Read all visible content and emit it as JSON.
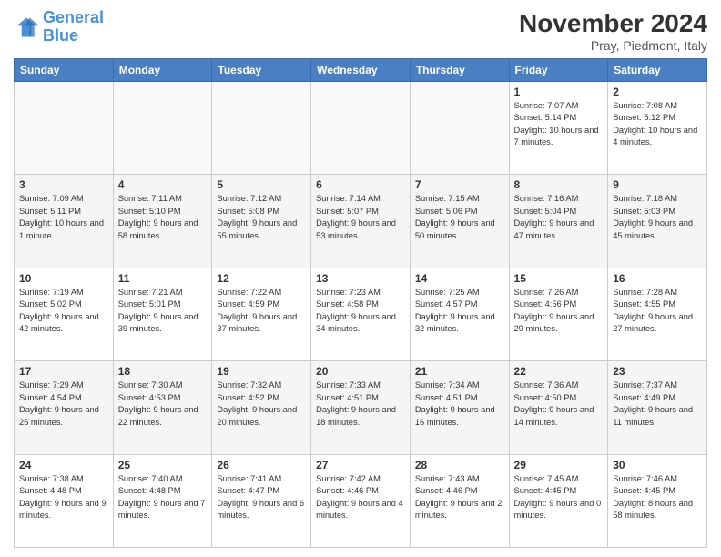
{
  "header": {
    "logo_line1": "General",
    "logo_line2": "Blue",
    "month_title": "November 2024",
    "location": "Pray, Piedmont, Italy"
  },
  "weekdays": [
    "Sunday",
    "Monday",
    "Tuesday",
    "Wednesday",
    "Thursday",
    "Friday",
    "Saturday"
  ],
  "rows": [
    [
      {
        "day": "",
        "info": ""
      },
      {
        "day": "",
        "info": ""
      },
      {
        "day": "",
        "info": ""
      },
      {
        "day": "",
        "info": ""
      },
      {
        "day": "",
        "info": ""
      },
      {
        "day": "1",
        "info": "Sunrise: 7:07 AM\nSunset: 5:14 PM\nDaylight: 10 hours and 7 minutes."
      },
      {
        "day": "2",
        "info": "Sunrise: 7:08 AM\nSunset: 5:12 PM\nDaylight: 10 hours and 4 minutes."
      }
    ],
    [
      {
        "day": "3",
        "info": "Sunrise: 7:09 AM\nSunset: 5:11 PM\nDaylight: 10 hours and 1 minute."
      },
      {
        "day": "4",
        "info": "Sunrise: 7:11 AM\nSunset: 5:10 PM\nDaylight: 9 hours and 58 minutes."
      },
      {
        "day": "5",
        "info": "Sunrise: 7:12 AM\nSunset: 5:08 PM\nDaylight: 9 hours and 55 minutes."
      },
      {
        "day": "6",
        "info": "Sunrise: 7:14 AM\nSunset: 5:07 PM\nDaylight: 9 hours and 53 minutes."
      },
      {
        "day": "7",
        "info": "Sunrise: 7:15 AM\nSunset: 5:06 PM\nDaylight: 9 hours and 50 minutes."
      },
      {
        "day": "8",
        "info": "Sunrise: 7:16 AM\nSunset: 5:04 PM\nDaylight: 9 hours and 47 minutes."
      },
      {
        "day": "9",
        "info": "Sunrise: 7:18 AM\nSunset: 5:03 PM\nDaylight: 9 hours and 45 minutes."
      }
    ],
    [
      {
        "day": "10",
        "info": "Sunrise: 7:19 AM\nSunset: 5:02 PM\nDaylight: 9 hours and 42 minutes."
      },
      {
        "day": "11",
        "info": "Sunrise: 7:21 AM\nSunset: 5:01 PM\nDaylight: 9 hours and 39 minutes."
      },
      {
        "day": "12",
        "info": "Sunrise: 7:22 AM\nSunset: 4:59 PM\nDaylight: 9 hours and 37 minutes."
      },
      {
        "day": "13",
        "info": "Sunrise: 7:23 AM\nSunset: 4:58 PM\nDaylight: 9 hours and 34 minutes."
      },
      {
        "day": "14",
        "info": "Sunrise: 7:25 AM\nSunset: 4:57 PM\nDaylight: 9 hours and 32 minutes."
      },
      {
        "day": "15",
        "info": "Sunrise: 7:26 AM\nSunset: 4:56 PM\nDaylight: 9 hours and 29 minutes."
      },
      {
        "day": "16",
        "info": "Sunrise: 7:28 AM\nSunset: 4:55 PM\nDaylight: 9 hours and 27 minutes."
      }
    ],
    [
      {
        "day": "17",
        "info": "Sunrise: 7:29 AM\nSunset: 4:54 PM\nDaylight: 9 hours and 25 minutes."
      },
      {
        "day": "18",
        "info": "Sunrise: 7:30 AM\nSunset: 4:53 PM\nDaylight: 9 hours and 22 minutes."
      },
      {
        "day": "19",
        "info": "Sunrise: 7:32 AM\nSunset: 4:52 PM\nDaylight: 9 hours and 20 minutes."
      },
      {
        "day": "20",
        "info": "Sunrise: 7:33 AM\nSunset: 4:51 PM\nDaylight: 9 hours and 18 minutes."
      },
      {
        "day": "21",
        "info": "Sunrise: 7:34 AM\nSunset: 4:51 PM\nDaylight: 9 hours and 16 minutes."
      },
      {
        "day": "22",
        "info": "Sunrise: 7:36 AM\nSunset: 4:50 PM\nDaylight: 9 hours and 14 minutes."
      },
      {
        "day": "23",
        "info": "Sunrise: 7:37 AM\nSunset: 4:49 PM\nDaylight: 9 hours and 11 minutes."
      }
    ],
    [
      {
        "day": "24",
        "info": "Sunrise: 7:38 AM\nSunset: 4:48 PM\nDaylight: 9 hours and 9 minutes."
      },
      {
        "day": "25",
        "info": "Sunrise: 7:40 AM\nSunset: 4:48 PM\nDaylight: 9 hours and 7 minutes."
      },
      {
        "day": "26",
        "info": "Sunrise: 7:41 AM\nSunset: 4:47 PM\nDaylight: 9 hours and 6 minutes."
      },
      {
        "day": "27",
        "info": "Sunrise: 7:42 AM\nSunset: 4:46 PM\nDaylight: 9 hours and 4 minutes."
      },
      {
        "day": "28",
        "info": "Sunrise: 7:43 AM\nSunset: 4:46 PM\nDaylight: 9 hours and 2 minutes."
      },
      {
        "day": "29",
        "info": "Sunrise: 7:45 AM\nSunset: 4:45 PM\nDaylight: 9 hours and 0 minutes."
      },
      {
        "day": "30",
        "info": "Sunrise: 7:46 AM\nSunset: 4:45 PM\nDaylight: 8 hours and 58 minutes."
      }
    ]
  ]
}
